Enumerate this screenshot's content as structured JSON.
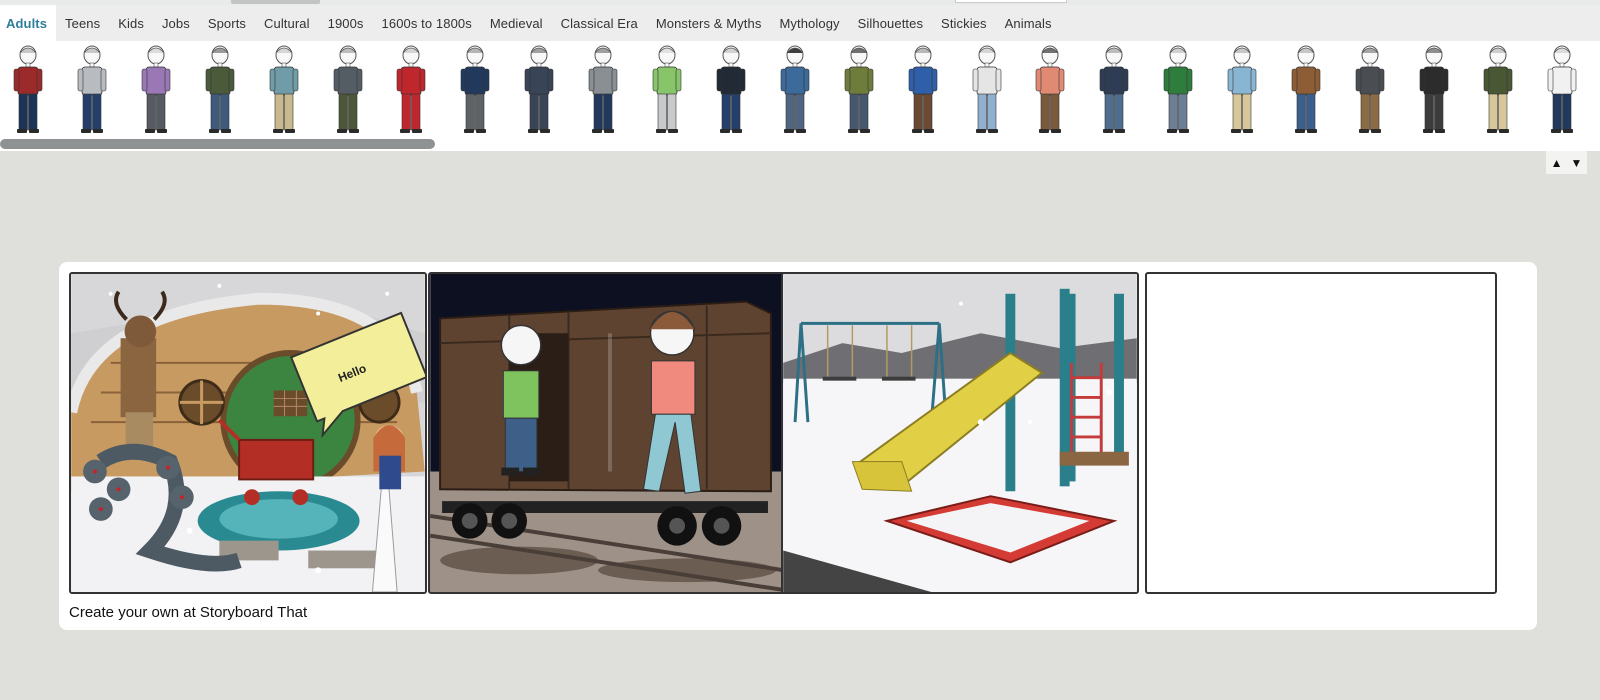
{
  "tabs": [
    "Adults",
    "Teens",
    "Kids",
    "Jobs",
    "Sports",
    "Cultural",
    "1900s",
    "1600s to 1800s",
    "Medieval",
    "Classical Era",
    "Monsters & Myths",
    "Mythology",
    "Silhouettes",
    "Stickies",
    "Animals"
  ],
  "active_tab": "Adults",
  "characters": [
    {
      "shirt": "#9b2b2b",
      "pants": "#1c3556",
      "hair": "#c9c9c9"
    },
    {
      "shirt": "#b8bcc0",
      "pants": "#24406a",
      "hair": "#c9c9c9"
    },
    {
      "shirt": "#9a78b5",
      "pants": "#555b61",
      "hair": "#dcdcdc"
    },
    {
      "shirt": "#4b5a3a",
      "pants": "#3e5a7c",
      "hair": "#9a9a9a"
    },
    {
      "shirt": "#6f9ca7",
      "pants": "#c9b98f",
      "hair": "#d6d6d6"
    },
    {
      "shirt": "#545d64",
      "pants": "#4d5638",
      "hair": "#bdbdbd"
    },
    {
      "shirt": "#c0272d",
      "pants": "#c0272d",
      "hair": "#d4d4d4"
    },
    {
      "shirt": "#22395e",
      "pants": "#5d6266",
      "hair": "#b5b5b5"
    },
    {
      "shirt": "#394456",
      "pants": "#394456",
      "hair": "#a0a0a0"
    },
    {
      "shirt": "#8a8f94",
      "pants": "#22395e",
      "hair": "#9f9f9f"
    },
    {
      "shirt": "#87c46a",
      "pants": "#c7c9cb",
      "hair": "#e1e1e1"
    },
    {
      "shirt": "#222a36",
      "pants": "#24406a",
      "hair": "#d2d2d2"
    },
    {
      "shirt": "#3c6a9a",
      "pants": "#4f6580",
      "hair": "#3d3d3d"
    },
    {
      "shirt": "#6f7d3c",
      "pants": "#45586e",
      "hair": "#6f6f6f"
    },
    {
      "shirt": "#2e5fa8",
      "pants": "#6a4a32",
      "hair": "#b8b8b8"
    },
    {
      "shirt": "#e5e5e5",
      "pants": "#8fb0cf",
      "hair": "#d6d6d6"
    },
    {
      "shirt": "#e08a74",
      "pants": "#7b5a3c",
      "hair": "#707070"
    },
    {
      "shirt": "#2e3d54",
      "pants": "#4f6d8f",
      "hair": "#bdbdbd"
    },
    {
      "shirt": "#2f7d3d",
      "pants": "#6d7f95",
      "hair": "#d0d0d0"
    },
    {
      "shirt": "#88b5d2",
      "pants": "#d8c79b",
      "hair": "#c6c6c6"
    },
    {
      "shirt": "#8d5e36",
      "pants": "#3b5f8c",
      "hair": "#c6c6c6"
    },
    {
      "shirt": "#4a4e53",
      "pants": "#8b6a44",
      "hair": "#a5a5a5"
    },
    {
      "shirt": "#2c2c2c",
      "pants": "#3c3c3c",
      "hair": "#8e8e8e"
    },
    {
      "shirt": "#4a5734",
      "pants": "#d8c79b",
      "hair": "#cdcdcd"
    },
    {
      "shirt": "#f1f1f1",
      "pants": "#22395e",
      "hair": "#dcdcdc"
    }
  ],
  "zoom_arrows": {
    "up": "▲",
    "down": "▼"
  },
  "storyboard": {
    "cells": [
      {
        "scene": "snowy-hobbit-hole-with-monsters",
        "speech_bubble": "Hello"
      },
      {
        "scene": "train-boxcar-with-teens"
      },
      {
        "scene": "snowy-playground"
      },
      {
        "scene": "empty"
      }
    ],
    "caption": "Create your own at Storyboard That"
  }
}
